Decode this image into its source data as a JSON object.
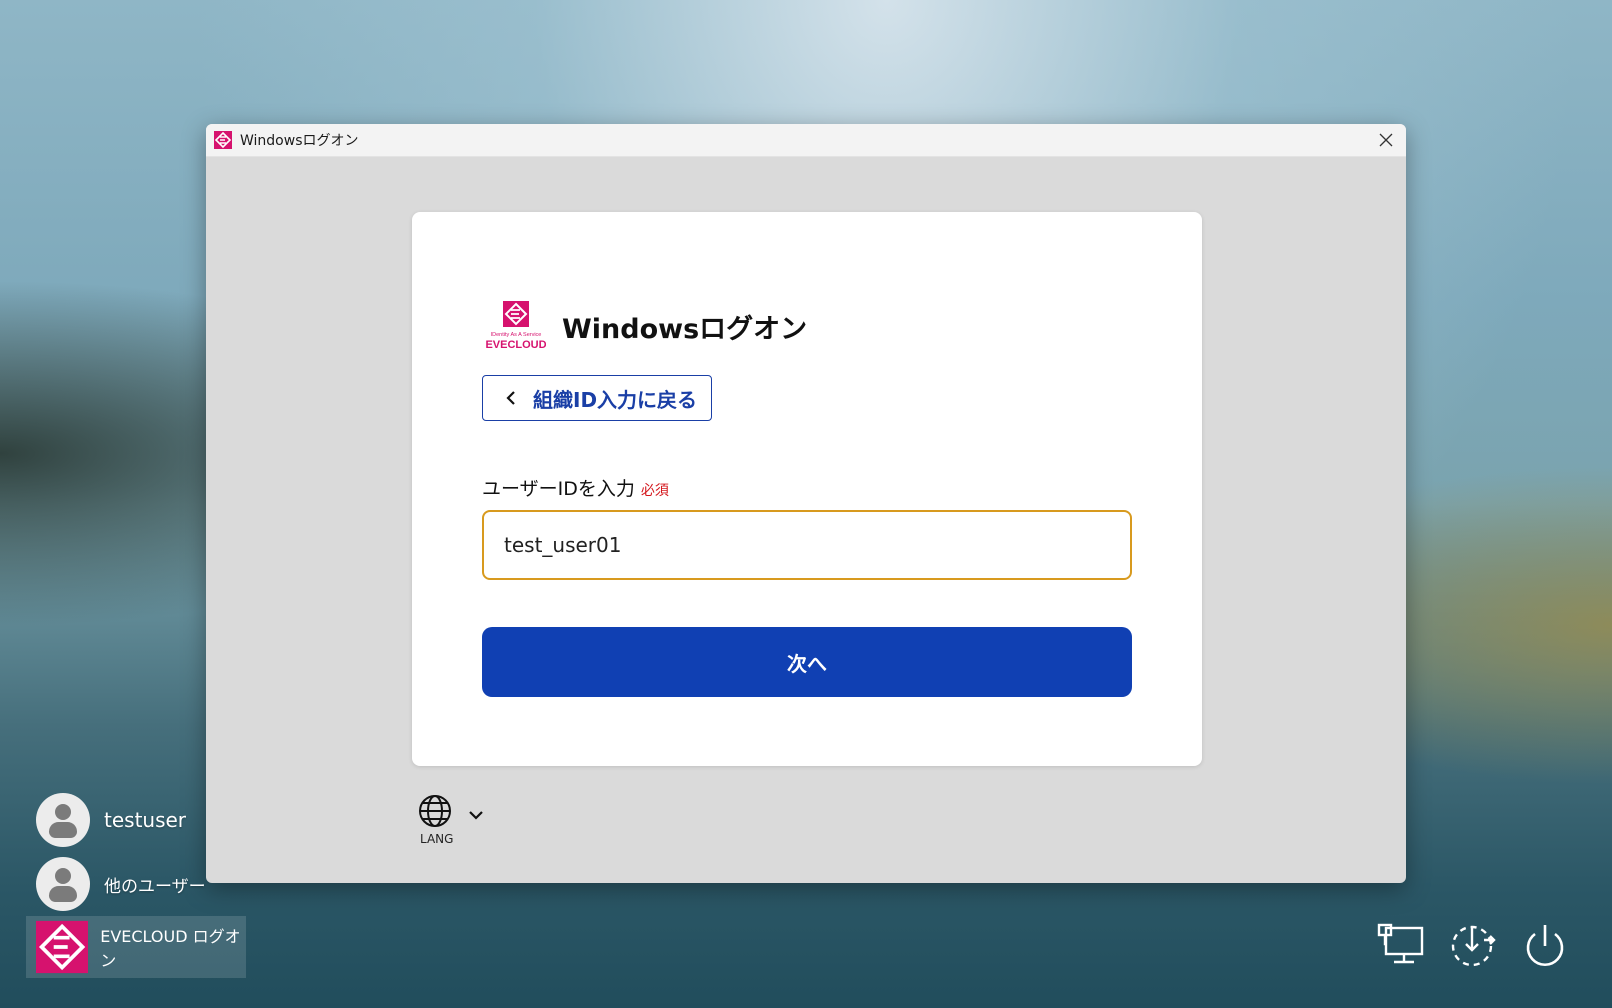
{
  "window": {
    "title": "Windowsログオン",
    "close_icon": "close-icon"
  },
  "card": {
    "title": "Windowsログオン",
    "logo": {
      "tagline": "IDentity As A Service",
      "name": "EVECLOUD"
    },
    "back_button_label": "組織ID入力に戻る",
    "field_label": "ユーザーIDを入力",
    "required_label": "必須",
    "user_id_value": "test_user01",
    "next_button_label": "次へ"
  },
  "language": {
    "label": "LANG",
    "icon": "globe-icon"
  },
  "users": [
    {
      "name": "testuser"
    },
    {
      "name": "他のユーザー"
    }
  ],
  "evecloud_tile": {
    "label": "EVECLOUD ログオン"
  },
  "system_icons": [
    "network-icon",
    "accessibility-icon",
    "power-icon"
  ],
  "colors": {
    "brand_magenta": "#d6126e",
    "primary_blue": "#1040b3",
    "input_border": "#d89a1e",
    "required_red": "#d4161c"
  }
}
